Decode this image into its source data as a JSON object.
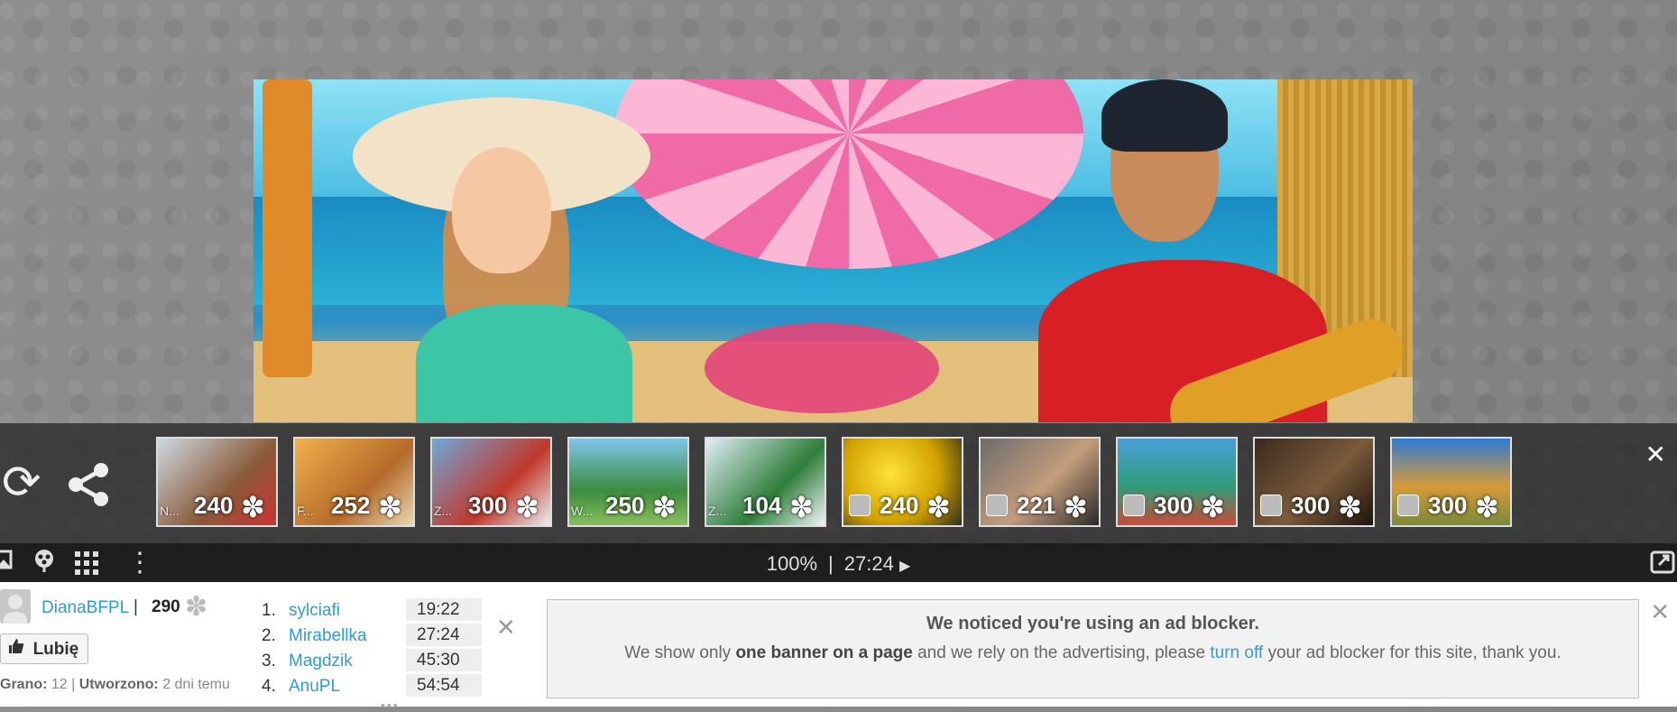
{
  "thumbnails": [
    {
      "label": "N...",
      "count": "240",
      "bg": "linear-gradient(135deg,#cfd9e3,#8a5a3a 60%,#c33)"
    },
    {
      "label": "F...",
      "count": "252",
      "bg": "linear-gradient(135deg,#f2b14c,#b56a2a 60%,#e8d7b0)"
    },
    {
      "label": "Z...",
      "count": "300",
      "bg": "linear-gradient(135deg,#6fa7d9,#c0392b 60%,#e9eef2)"
    },
    {
      "label": "W...",
      "count": "250",
      "bg": "linear-gradient(180deg,#7fc6ea,#3c8c3e 60%,#8bbf5e)"
    },
    {
      "label": "Z...",
      "count": "104",
      "bg": "linear-gradient(135deg,#e0eef7,#2f7d3a 60%,#f0f4f7)"
    },
    {
      "label": "",
      "count": "240",
      "bg": "radial-gradient(circle at 40% 40%,#ffe23a,#d1a200 55%,#2e2e1e)"
    },
    {
      "label": "",
      "count": "221",
      "bg": "linear-gradient(135deg,#6d6d6d,#c49c7c 55%,#2a2a2a)"
    },
    {
      "label": "",
      "count": "300",
      "bg": "linear-gradient(180deg,#4aa0d8,#2f9c7a 55%,#c94a3a)"
    },
    {
      "label": "",
      "count": "300",
      "bg": "linear-gradient(135deg,#3c2a1e,#7a5a3a 55%,#1e140e)"
    },
    {
      "label": "",
      "count": "300",
      "bg": "linear-gradient(180deg,#2d7bd6,#d79a3a 55%,#7a8a3a)"
    }
  ],
  "toolbar": {
    "zoom": "100%",
    "separator": "|",
    "time": "27:24",
    "play_symbol": "▶"
  },
  "user": {
    "name": "DianaBFPL",
    "separator": "|",
    "score": "290",
    "like_label": "Lubię",
    "meta_played_label": "Grano:",
    "meta_played_value": "12",
    "meta_created_label": "Utworzono:",
    "meta_created_value": "2 dni temu"
  },
  "ranking": [
    {
      "pos": "1.",
      "name": "sylciafi",
      "time": "19:22"
    },
    {
      "pos": "2.",
      "name": "Mirabellka",
      "time": "27:24"
    },
    {
      "pos": "3.",
      "name": "Magdzik",
      "time": "45:30"
    },
    {
      "pos": "4.",
      "name": "AnuPL",
      "time": "54:54"
    }
  ],
  "ad_notice": {
    "title": "We noticed you're using an ad blocker.",
    "text_before": "We show only ",
    "text_bold": "one banner on a page",
    "text_middle": " and we rely on the advertising, please ",
    "link": "turn off",
    "text_after": " your ad blocker for this site, thank you."
  },
  "icons": {
    "close": "✕",
    "refresh": "⟳",
    "puzzle": "✽",
    "like": "👍",
    "grid": "▦",
    "kebab": "⋮",
    "more": "•••"
  }
}
